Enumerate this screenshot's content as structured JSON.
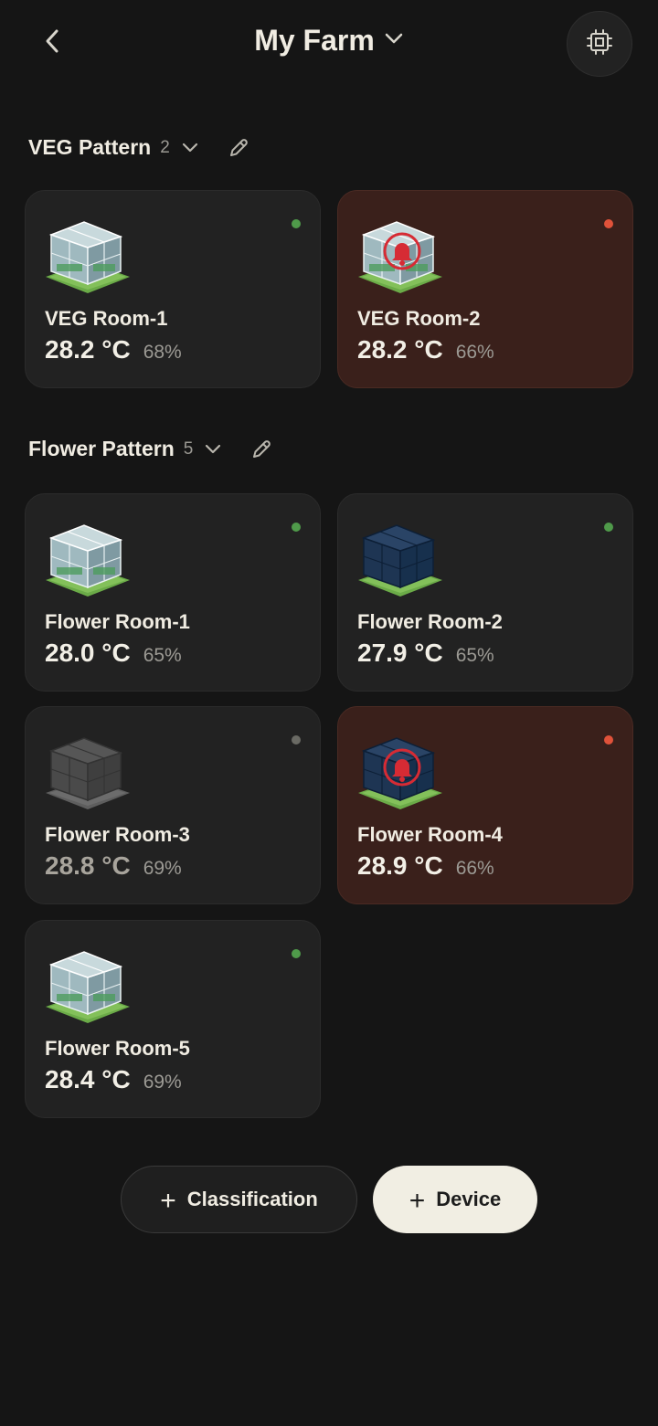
{
  "header": {
    "title": "My Farm"
  },
  "icons": {
    "back": "chevron-left-icon",
    "title_dropdown": "chevron-down-icon",
    "device_chip": "chip-icon",
    "edit": "pencil-icon",
    "alert": "bell-icon",
    "room": "greenhouse-icon"
  },
  "colors": {
    "status_online": "#4f9a4a",
    "status_alert": "#e0523a",
    "status_offline": "#6a6a64",
    "alert_card_bg": "#3a201b"
  },
  "sections": [
    {
      "name": "VEG Pattern",
      "count": "2",
      "rooms": [
        {
          "name": "VEG Room-1",
          "temp": "28.2 °C",
          "humidity": "68%",
          "status": "online"
        },
        {
          "name": "VEG Room-2",
          "temp": "28.2 °C",
          "humidity": "66%",
          "status": "alert"
        }
      ]
    },
    {
      "name": "Flower Pattern",
      "count": "5",
      "rooms": [
        {
          "name": "Flower Room-1",
          "temp": "28.0 °C",
          "humidity": "65%",
          "status": "online"
        },
        {
          "name": "Flower Room-2",
          "temp": "27.9 °C",
          "humidity": "65%",
          "status": "online"
        },
        {
          "name": "Flower Room-3",
          "temp": "28.8 °C",
          "humidity": "69%",
          "status": "offline"
        },
        {
          "name": "Flower Room-4",
          "temp": "28.9 °C",
          "humidity": "66%",
          "status": "alert"
        },
        {
          "name": "Flower Room-5",
          "temp": "28.4 °C",
          "humidity": "69%",
          "status": "online"
        }
      ]
    }
  ],
  "actions": {
    "add_classification": "Classification",
    "add_device": "Device"
  }
}
